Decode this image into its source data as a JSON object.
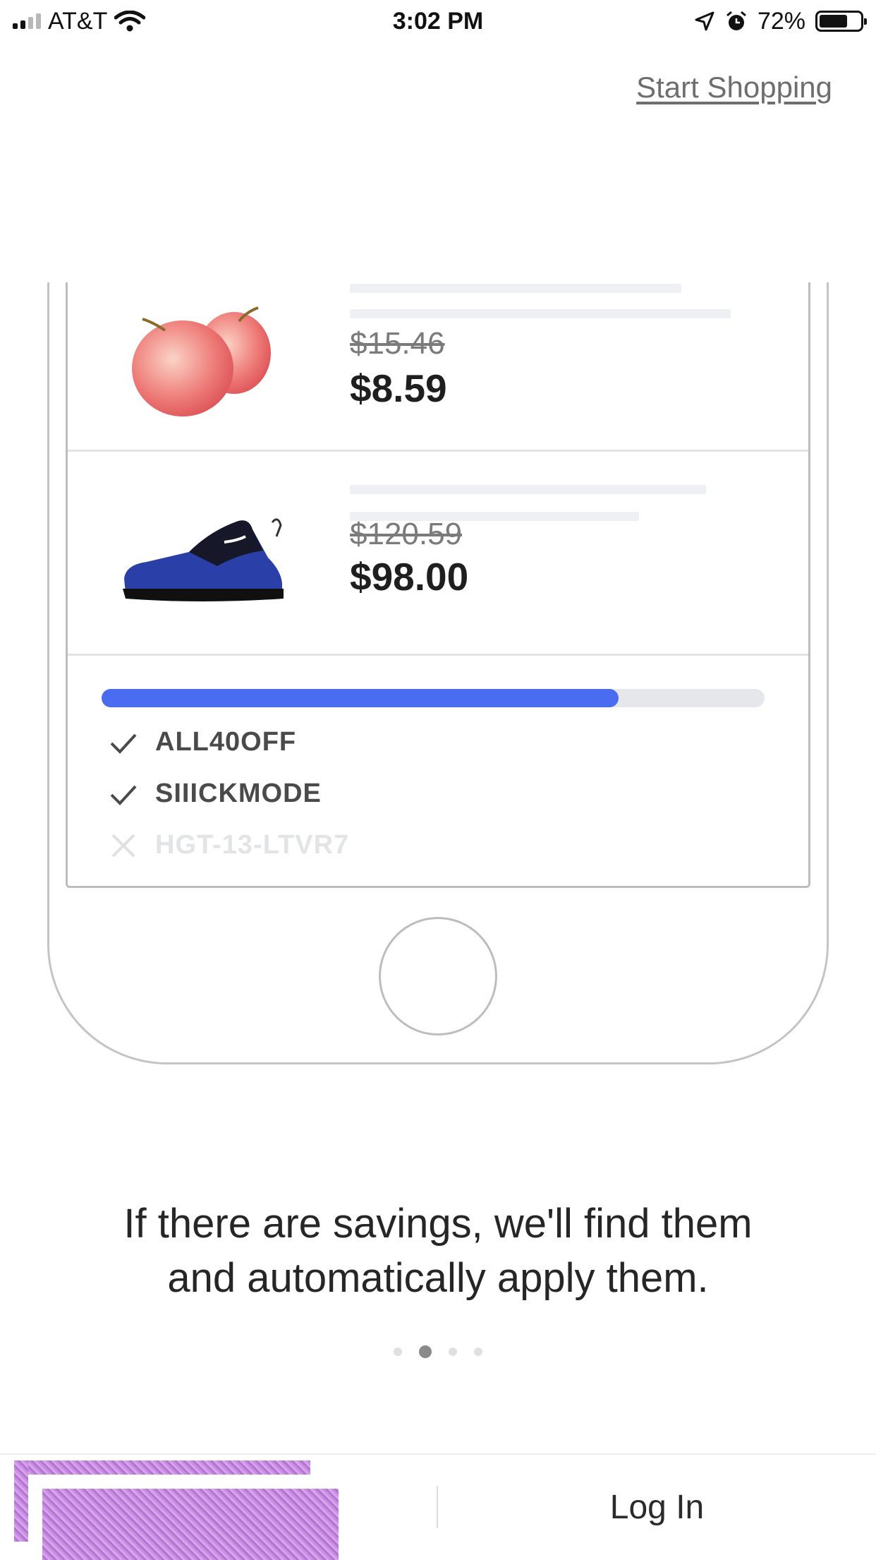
{
  "status_bar": {
    "carrier": "AT&T",
    "time": "3:02 PM",
    "battery_percent": "72%",
    "battery_level": 0.72,
    "icons": [
      "signal-icon",
      "wifi-icon",
      "location-icon",
      "alarm-icon",
      "battery-icon"
    ]
  },
  "header": {
    "start_shopping": "Start Shopping"
  },
  "illustration": {
    "products": [
      {
        "image": "apples",
        "old_price": "$15.46",
        "new_price": "$8.59"
      },
      {
        "image": "sneaker",
        "old_price": "$120.59",
        "new_price": "$98.00"
      }
    ],
    "progress": 0.78,
    "progress_color": "#4a6cf0",
    "coupons": [
      {
        "code": "ALL40OFF",
        "status": "applied"
      },
      {
        "code": "SIIICKMODE",
        "status": "applied"
      },
      {
        "code": "HGT-13-LTVR7",
        "status": "failed"
      }
    ]
  },
  "onboarding": {
    "headline": "If there are savings, we'll find them\nand automatically apply them.",
    "page_count": 4,
    "active_page": 1
  },
  "bottom_bar": {
    "login": "Log In"
  }
}
